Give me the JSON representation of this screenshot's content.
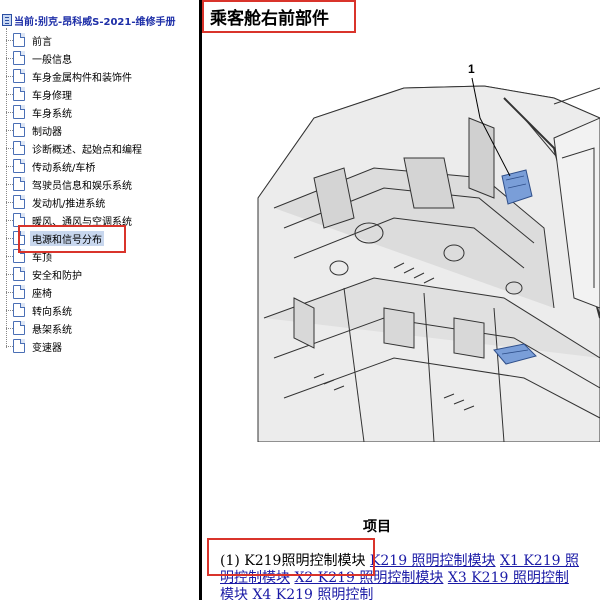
{
  "tree": {
    "root_label": "当前:别克-昂科威S-2021-维修手册",
    "items": [
      {
        "label": "前言"
      },
      {
        "label": "一般信息"
      },
      {
        "label": "车身金属构件和装饰件"
      },
      {
        "label": "车身修理"
      },
      {
        "label": "车身系统"
      },
      {
        "label": "制动器"
      },
      {
        "label": "诊断概述、起始点和编程"
      },
      {
        "label": "传动系统/车桥"
      },
      {
        "label": "驾驶员信息和娱乐系统"
      },
      {
        "label": "发动机/推进系统"
      },
      {
        "label": "暖风、通风与空调系统"
      },
      {
        "label": "电源和信号分布",
        "selected": true
      },
      {
        "label": "车顶"
      },
      {
        "label": "安全和防护"
      },
      {
        "label": "座椅"
      },
      {
        "label": "转向系统"
      },
      {
        "label": "悬架系统"
      },
      {
        "label": "变速器"
      }
    ]
  },
  "content": {
    "title": "乘客舱右前部件",
    "figure_callout": "1",
    "items_heading": "项目",
    "parts_row": {
      "prefix": "(1) K219照明控制模块",
      "links": [
        "K219 照明控制模块",
        "X1 K219 照明控制模块",
        "X2 K219 照明控制模块",
        "X3 K219 照明控制模块",
        "X4 K219 照明控制"
      ]
    }
  },
  "colors": {
    "highlight": "#d9342b",
    "root_text": "#1e2fa8",
    "link": "#1a1aa6",
    "selected_bg": "#c8d7ee"
  }
}
